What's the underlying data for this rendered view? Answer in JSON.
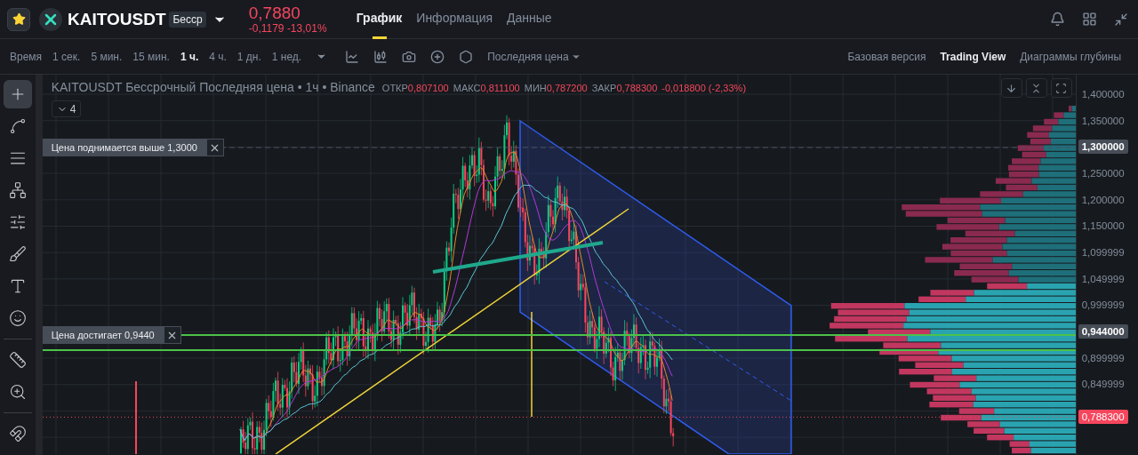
{
  "header": {
    "favorite": true,
    "symbol": "KAITOUSDT",
    "badge": "Бесср",
    "price": "0,7880",
    "change": "-0,1179",
    "change_pct": "-13,01%",
    "tabs": [
      {
        "label": "График",
        "selected": true
      },
      {
        "label": "Информация",
        "selected": false
      },
      {
        "label": "Данные",
        "selected": false
      }
    ]
  },
  "toolbar": {
    "time_label": "Время",
    "intervals": [
      {
        "label": "1 сек.",
        "selected": false
      },
      {
        "label": "5 мин.",
        "selected": false
      },
      {
        "label": "15 мин.",
        "selected": false
      },
      {
        "label": "1 ч.",
        "selected": true
      },
      {
        "label": "4 ч.",
        "selected": false
      },
      {
        "label": "1 дн.",
        "selected": false
      },
      {
        "label": "1 нед.",
        "selected": false
      }
    ],
    "price_type": "Последняя цена",
    "views": [
      {
        "label": "Базовая версия",
        "selected": false
      },
      {
        "label": "Trading View",
        "selected": true
      },
      {
        "label": "Диаграммы глубины",
        "selected": false
      }
    ]
  },
  "tools": [
    {
      "selected": true
    },
    {
      "selected": false
    },
    {
      "selected": false
    },
    {
      "selected": false
    },
    {
      "selected": false
    },
    {
      "selected": false
    },
    {
      "selected": false
    },
    {
      "selected": false
    },
    {
      "selected": false
    },
    {
      "selected": false
    },
    {
      "selected": false
    }
  ],
  "chart": {
    "title": "KAITOUSDT Бессрочный Последняя цена • 1ч • Binance",
    "ohlc": [
      {
        "label": "ОТКР",
        "value": "0,807100"
      },
      {
        "label": "МАКС",
        "value": "0,811100"
      },
      {
        "label": "МИН",
        "value": "0,787200"
      },
      {
        "label": "ЗАКР",
        "value": "0,788300"
      }
    ],
    "change": "-0,018800 (-2,33%)",
    "indicators_count": "4",
    "alerts": [
      {
        "text": "Цена поднимается выше 1,3000"
      },
      {
        "text": "Цена достигает 0,9440"
      }
    ],
    "axis": [
      {
        "label": "1,400000",
        "kind": "tick"
      },
      {
        "label": "1,350000",
        "kind": "tick"
      },
      {
        "label": "1,300000",
        "kind": "alert"
      },
      {
        "label": "1,250000",
        "kind": "tick"
      },
      {
        "label": "1,200000",
        "kind": "tick"
      },
      {
        "label": "1,150000",
        "kind": "tick"
      },
      {
        "label": "1,099999",
        "kind": "tick"
      },
      {
        "label": "1,049999",
        "kind": "tick"
      },
      {
        "label": "0,999999",
        "kind": "tick"
      },
      {
        "label": "0,944000",
        "kind": "alert"
      },
      {
        "label": "0,899999",
        "kind": "tick"
      },
      {
        "label": "0,849999",
        "kind": "tick"
      }
    ],
    "current_price": "0,788300"
  }
}
